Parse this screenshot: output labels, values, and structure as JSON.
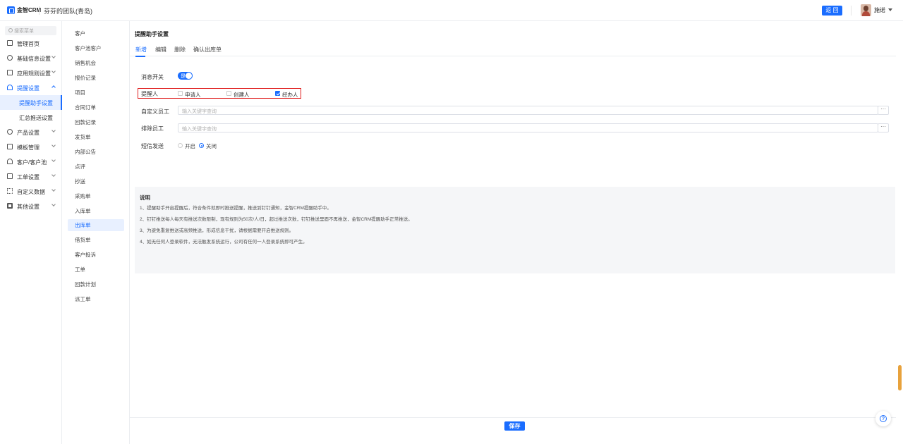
{
  "topbar": {
    "brand": "金智CRM",
    "team": "芬芬的团队(青岛)",
    "back_label": "返 回",
    "username": "施诺"
  },
  "sidebar": {
    "search_placeholder": "搜索菜单",
    "items": [
      {
        "label": "管理首页",
        "icon": "home-icon"
      },
      {
        "label": "基础信息设置",
        "icon": "settings-icon"
      },
      {
        "label": "应用规则设置",
        "icon": "document-icon"
      },
      {
        "label": "提醒设置",
        "icon": "bell-icon"
      },
      {
        "label": "提醒助手设置"
      },
      {
        "label": "汇总推送设置"
      },
      {
        "label": "产品设置",
        "icon": "product-icon"
      },
      {
        "label": "模板管理",
        "icon": "template-icon"
      },
      {
        "label": "客户/客户池",
        "icon": "customers-icon"
      },
      {
        "label": "工单设置",
        "icon": "ticket-icon"
      },
      {
        "label": "自定义数据",
        "icon": "custom-data-icon"
      },
      {
        "label": "其他设置",
        "icon": "grid-icon"
      }
    ]
  },
  "submenu": {
    "items": [
      "客户",
      "客户池客户",
      "销售机会",
      "报价记录",
      "项目",
      "合同订单",
      "回款记录",
      "发货单",
      "内部公告",
      "点评",
      "抄送",
      "采购单",
      "入库单",
      "出库单",
      "借货单",
      "客户投诉",
      "工单",
      "回款计划",
      "派工单"
    ],
    "selected": "出库单"
  },
  "main": {
    "title": "提醒助手设置",
    "tabs": [
      "新增",
      "编辑",
      "删除",
      "确认出库单"
    ],
    "active_tab": "新增",
    "form": {
      "message_switch_label": "消息开关",
      "switch_text": "是",
      "reminder_label": "提醒人",
      "reminder_options": [
        {
          "label": "申请人",
          "checked": false
        },
        {
          "label": "创建人",
          "checked": false
        },
        {
          "label": "经办人",
          "checked": true
        }
      ],
      "custom_staff_label": "自定义员工",
      "custom_staff_placeholder": "输入关键字查询",
      "exclude_staff_label": "排除员工",
      "exclude_staff_placeholder": "输入关键字查询",
      "sms_label": "短信发送",
      "sms_options": [
        {
          "label": "开启",
          "selected": false
        },
        {
          "label": "关闭",
          "selected": true
        }
      ],
      "dots": "···"
    },
    "notes": {
      "title": "说明",
      "lines": [
        "1、提醒助手开启提醒后，符合条件就即时推送提醒，推送到钉钉通知，金智CRM提醒助手中。",
        "2、钉钉推送每人每天有推送次数限制，现有规则为50次/人/日，超过推送次数，钉钉推送里面不再推送，金智CRM提醒助手正常推送。",
        "3、为避免重复推送或高频推送，形成信息干扰，请根据需要开启推送规则。",
        "4、如无任何人登录软件，无法触发系统运行，公司有任何一人登录系统即可产生。"
      ]
    },
    "save_label": "保存"
  },
  "help": "?",
  "colors": {
    "accent": "#1a6dff",
    "highlight_border": "#e02020"
  }
}
